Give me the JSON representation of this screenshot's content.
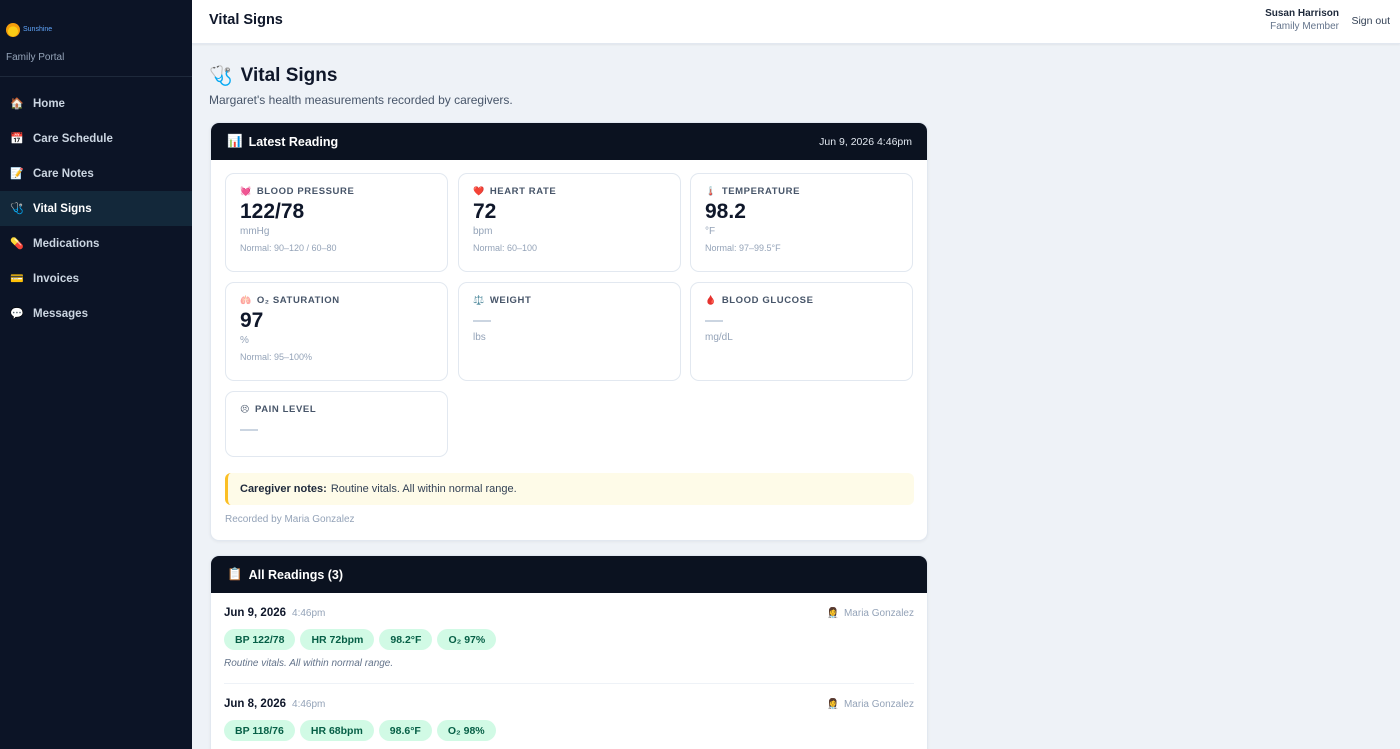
{
  "brand": {
    "logo_text": "Sunshine",
    "portal_label": "Family Portal"
  },
  "nav": [
    {
      "label": "Home",
      "icon": "house-icon",
      "glyph": "🏠",
      "active": false
    },
    {
      "label": "Care Schedule",
      "icon": "calendar-icon",
      "glyph": "📅",
      "active": false
    },
    {
      "label": "Care Notes",
      "icon": "notes-icon",
      "glyph": "📝",
      "active": false
    },
    {
      "label": "Vital Signs",
      "icon": "stethoscope-icon",
      "glyph": "🩺",
      "active": true
    },
    {
      "label": "Medications",
      "icon": "pill-icon",
      "glyph": "💊",
      "active": false
    },
    {
      "label": "Invoices",
      "icon": "credit-card-icon",
      "glyph": "💳",
      "active": false
    },
    {
      "label": "Messages",
      "icon": "speech-bubble-icon",
      "glyph": "💬",
      "active": false
    }
  ],
  "topbar": {
    "title": "Vital Signs",
    "user_name": "Susan Harrison",
    "user_role": "Family Member",
    "signout_label": "Sign out"
  },
  "page": {
    "title": "Vital Signs",
    "title_icon": "🩺",
    "subtitle": "Margaret's health measurements recorded by caregivers."
  },
  "latest": {
    "title": "Latest Reading",
    "title_icon": "📊",
    "date": "Jun 9, 2026 4:46pm",
    "vitals": [
      {
        "label": "BLOOD PRESSURE",
        "icon": "💓",
        "value": "122/78",
        "unit": "mmHg",
        "normal": "Normal: 90–120 / 60–80"
      },
      {
        "label": "HEART RATE",
        "icon": "❤️",
        "value": "72",
        "unit": "bpm",
        "normal": "Normal: 60–100"
      },
      {
        "label": "TEMPERATURE",
        "icon": "🌡️",
        "value": "98.2",
        "unit": "°F",
        "normal": "Normal: 97–99.5°F"
      },
      {
        "label": "O₂ SATURATION",
        "icon": "🫁",
        "value": "97",
        "unit": "%",
        "normal": "Normal: 95–100%"
      },
      {
        "label": "WEIGHT",
        "icon": "⚖️",
        "value": "",
        "unit": "lbs",
        "normal": ""
      },
      {
        "label": "BLOOD GLUCOSE",
        "icon": "🩸",
        "value": "",
        "unit": "mg/dL",
        "normal": ""
      },
      {
        "label": "PAIN LEVEL",
        "icon": "😣",
        "value": "",
        "unit": "",
        "normal": ""
      }
    ],
    "note_label": "Caregiver notes:",
    "note_text": "Routine vitals. All within normal range.",
    "recorded_by": "Recorded by Maria Gonzalez"
  },
  "all_readings": {
    "title": "All Readings (3)",
    "title_icon": "📋",
    "items": [
      {
        "date": "Jun 9, 2026",
        "time": "4:46pm",
        "by": "Maria Gonzalez",
        "chips": [
          "BP 122/78",
          "HR 72bpm",
          "98.2°F",
          "O₂ 97%"
        ],
        "note": "Routine vitals. All within normal range."
      },
      {
        "date": "Jun 8, 2026",
        "time": "4:46pm",
        "by": "Maria Gonzalez",
        "chips": [
          "BP 118/76",
          "HR 68bpm",
          "98.6°F",
          "O₂ 98%"
        ],
        "note": ""
      }
    ]
  }
}
